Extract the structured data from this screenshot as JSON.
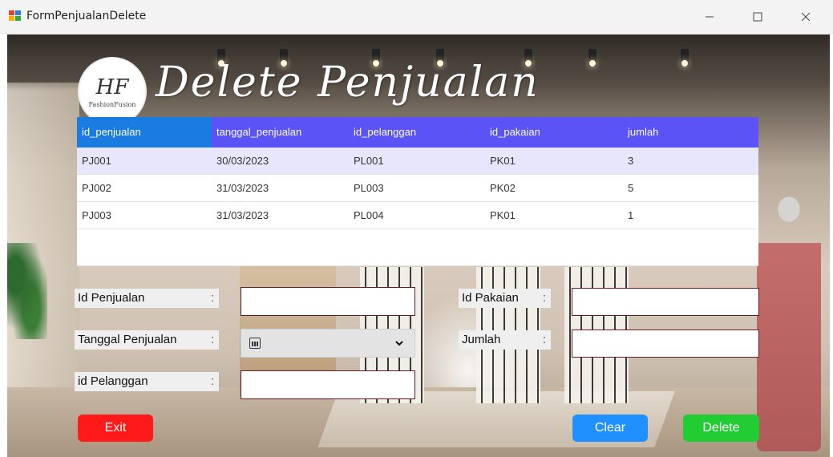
{
  "window": {
    "title": "FormPenjualanDelete"
  },
  "header": {
    "logo_monogram": "HF",
    "logo_brand": "FashionFusion",
    "title": "Delete Penjualan"
  },
  "table": {
    "columns": [
      "id_penjualan",
      "tanggal_penjualan",
      "id_pelanggan",
      "id_pakaian",
      "jumlah"
    ],
    "rows": [
      [
        "PJ001",
        "30/03/2023",
        "PL001",
        "PK01",
        "3"
      ],
      [
        "PJ002",
        "31/03/2023",
        "PL003",
        "PK02",
        "5"
      ],
      [
        "PJ003",
        "31/03/2023",
        "PL004",
        "PK01",
        "1"
      ]
    ]
  },
  "form": {
    "id_penjualan_label": "Id Penjualan",
    "tanggal_penjualan_label": "Tanggal Penjualan",
    "id_pelanggan_label": "id Pelanggan",
    "id_pakaian_label": "Id Pakaian",
    "jumlah_label": "Jumlah",
    "colon": ":",
    "id_penjualan_value": "",
    "tanggal_penjualan_value": "",
    "id_pelanggan_value": "",
    "id_pakaian_value": "",
    "jumlah_value": ""
  },
  "buttons": {
    "exit": "Exit",
    "clear": "Clear",
    "delete": "Delete"
  },
  "colors": {
    "header_bg": "#5b53f5",
    "selected_header": "#1a7be0",
    "exit": "#ff1a1a",
    "clear": "#2090ff",
    "delete": "#22cc33",
    "input_border": "#6a1a22"
  },
  "icons": {
    "app": "winforms-app-icon",
    "calendar": "calendar-icon",
    "dropdown": "chevron-down-icon"
  }
}
